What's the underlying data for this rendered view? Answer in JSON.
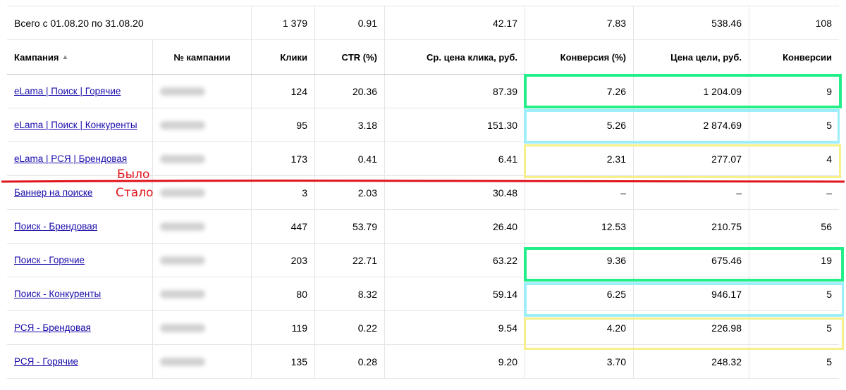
{
  "totals": {
    "label": "Всего с 01.08.20 по 31.08.20",
    "clicks": "1 379",
    "ctr": "0.91",
    "avg_cpc": "42.17",
    "conversion_rate": "7.83",
    "cost_per_goal": "538.46",
    "conversions": "108"
  },
  "headers": {
    "campaign": "Кампания",
    "sort_indicator": "▲",
    "campaign_id": "№ кампании",
    "clicks": "Клики",
    "ctr": "CTR (%)",
    "avg_cpc": "Ср. цена клика, руб.",
    "conversion_rate": "Конверсия (%)",
    "cost_per_goal": "Цена цели, руб.",
    "conversions": "Конверсии"
  },
  "rows": [
    {
      "campaign": "eLama | Поиск | Горячие",
      "clicks": "124",
      "ctr": "20.36",
      "avg_cpc": "87.39",
      "conversion_rate": "7.26",
      "cost_per_goal": "1 204.09",
      "conversions": "9"
    },
    {
      "campaign": "eLama | Поиск | Конкуренты",
      "clicks": "95",
      "ctr": "3.18",
      "avg_cpc": "151.30",
      "conversion_rate": "5.26",
      "cost_per_goal": "2 874.69",
      "conversions": "5"
    },
    {
      "campaign": "eLama | РСЯ | Брендовая",
      "clicks": "173",
      "ctr": "0.41",
      "avg_cpc": "6.41",
      "conversion_rate": "2.31",
      "cost_per_goal": "277.07",
      "conversions": "4"
    },
    {
      "campaign": "Баннер на поиске",
      "clicks": "3",
      "ctr": "2.03",
      "avg_cpc": "30.48",
      "conversion_rate": "–",
      "cost_per_goal": "–",
      "conversions": "–"
    },
    {
      "campaign": "Поиск - Брендовая",
      "clicks": "447",
      "ctr": "53.79",
      "avg_cpc": "26.40",
      "conversion_rate": "12.53",
      "cost_per_goal": "210.75",
      "conversions": "56"
    },
    {
      "campaign": "Поиск - Горячие",
      "clicks": "203",
      "ctr": "22.71",
      "avg_cpc": "63.22",
      "conversion_rate": "9.36",
      "cost_per_goal": "675.46",
      "conversions": "19"
    },
    {
      "campaign": "Поиск - Конкуренты",
      "clicks": "80",
      "ctr": "8.32",
      "avg_cpc": "59.14",
      "conversion_rate": "6.25",
      "cost_per_goal": "946.17",
      "conversions": "5"
    },
    {
      "campaign": "РСЯ - Брендовая",
      "clicks": "119",
      "ctr": "0.22",
      "avg_cpc": "9.54",
      "conversion_rate": "4.20",
      "cost_per_goal": "226.98",
      "conversions": "5"
    },
    {
      "campaign": "РСЯ - Горячие",
      "clicks": "135",
      "ctr": "0.28",
      "avg_cpc": "9.20",
      "conversion_rate": "3.70",
      "cost_per_goal": "248.32",
      "conversions": "5"
    }
  ],
  "annotations": {
    "before": "Было",
    "after": "Стало"
  },
  "colors": {
    "link": "#1a0dab",
    "highlight_green": "#22ee8a",
    "highlight_cyan": "#9eeefa",
    "highlight_yellow": "#f6f08a",
    "annotation_red": "#e0141c"
  }
}
